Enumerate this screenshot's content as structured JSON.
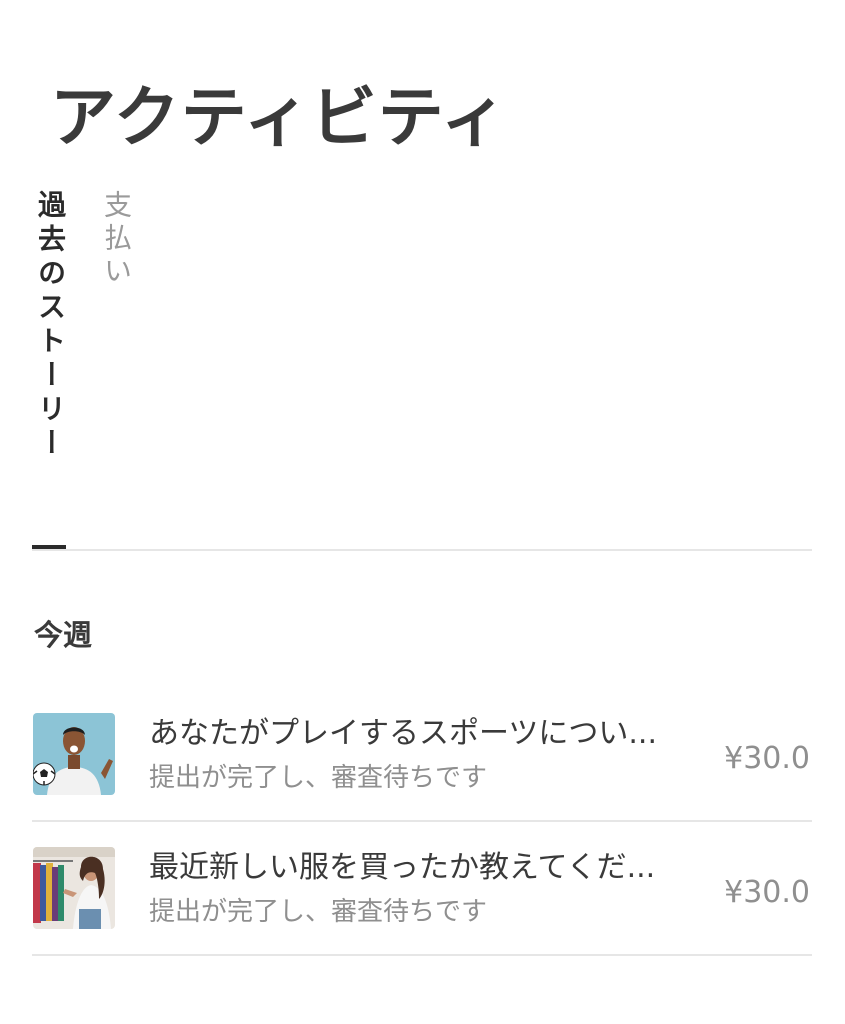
{
  "header": {
    "title": "アクティビティ"
  },
  "tabs": [
    {
      "label": "過去のストーリー",
      "active": true
    },
    {
      "label": "支払い",
      "active": false
    }
  ],
  "section": {
    "heading": "今週"
  },
  "activities": [
    {
      "title": "あなたがプレイするスポーツについ...",
      "status": "提出が完了し、審査待ちです",
      "amount": "¥30.0",
      "thumbnail_icon": "sports-photo"
    },
    {
      "title": "最近新しい服を買ったか教えてくだ...",
      "status": "提出が完了し、審査待ちです",
      "amount": "¥30.0",
      "thumbnail_icon": "clothing-photo"
    }
  ],
  "colors": {
    "text_primary": "#3a3a3a",
    "text_secondary": "#8f8f8f",
    "divider": "#e6e6e6",
    "tab_indicator": "#2b2b2b"
  }
}
